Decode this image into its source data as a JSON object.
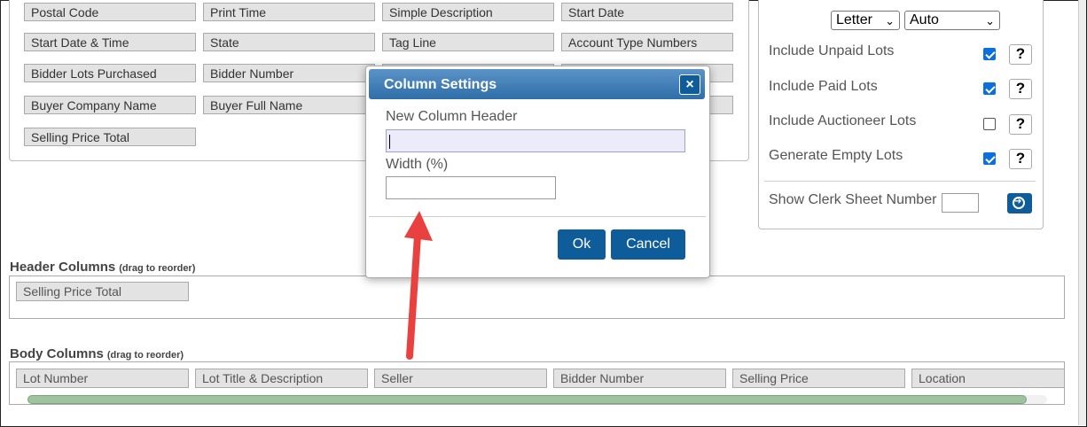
{
  "available_fields": [
    [
      "Postal Code",
      "Print Time",
      "Simple Description",
      "Start Date"
    ],
    [
      "Start Date & Time",
      "State",
      "Tag Line",
      "Account Type Numbers"
    ],
    [
      "Bidder Lots Purchased",
      "Bidder Number",
      "",
      ""
    ],
    [
      "Buyer Company Name",
      "Buyer Full Name",
      "",
      ""
    ],
    [
      "Selling Price Total"
    ]
  ],
  "options": {
    "paper_size": "Letter",
    "orientation": "Auto",
    "toggles": [
      {
        "label": "Include Unpaid Lots",
        "checked": true,
        "help": "?"
      },
      {
        "label": "Include Paid Lots",
        "checked": true,
        "help": "?"
      },
      {
        "label": "Include Auctioneer Lots",
        "checked": false,
        "help": "?"
      },
      {
        "label": "Generate Empty Lots",
        "checked": true,
        "help": "?"
      }
    ],
    "clerk_sheet_label": "Show Clerk Sheet Number",
    "clerk_sheet_value": ""
  },
  "header_columns": {
    "title": "Header Columns",
    "hint": "(drag to reorder)",
    "items": [
      "Selling Price Total"
    ]
  },
  "body_columns": {
    "title": "Body Columns",
    "hint": "(drag to reorder)",
    "items": [
      "Lot Number",
      "Lot Title & Description",
      "Seller",
      "Bidder Number",
      "Selling Price",
      "Location"
    ],
    "scroll_visible_fraction": 0.98
  },
  "modal": {
    "title": "Column Settings",
    "close_glyph": "×",
    "header_label": "New Column Header",
    "header_value": "",
    "width_label": "Width (%)",
    "width_value": "",
    "ok_label": "Ok",
    "cancel_label": "Cancel"
  },
  "colors": {
    "accent": "#0f5c9a",
    "annotation_arrow": "#e8413f"
  }
}
